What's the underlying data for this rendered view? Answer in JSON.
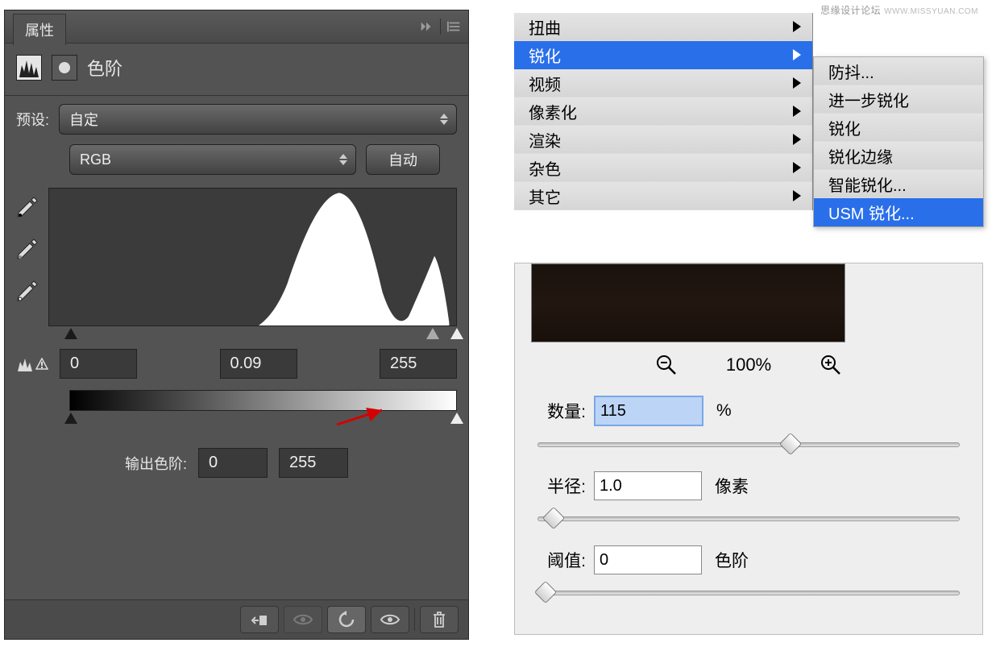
{
  "watermark": {
    "cn": "思缘设计论坛",
    "en": "WWW.MISSYUAN.COM"
  },
  "levels": {
    "panel_title": "属性",
    "title": "色阶",
    "preset_label": "预设:",
    "preset_value": "自定",
    "channel_value": "RGB",
    "auto_label": "自动",
    "input_black": "0",
    "input_gamma": "0.09",
    "input_white": "255",
    "output_label": "输出色阶:",
    "output_black": "0",
    "output_white": "255"
  },
  "menu": {
    "main": [
      {
        "label": "扭曲",
        "hl": false
      },
      {
        "label": "锐化",
        "hl": true
      },
      {
        "label": "视频",
        "hl": false
      },
      {
        "label": "像素化",
        "hl": false
      },
      {
        "label": "渲染",
        "hl": false
      },
      {
        "label": "杂色",
        "hl": false
      },
      {
        "label": "其它",
        "hl": false
      }
    ],
    "sub": [
      {
        "label": "防抖...",
        "hl": false
      },
      {
        "label": "进一步锐化",
        "hl": false
      },
      {
        "label": "锐化",
        "hl": false
      },
      {
        "label": "锐化边缘",
        "hl": false
      },
      {
        "label": "智能锐化...",
        "hl": false
      },
      {
        "label": "USM 锐化...",
        "hl": true
      }
    ]
  },
  "usm": {
    "zoom_text": "100%",
    "amount_label": "数量:",
    "amount_value": "115",
    "amount_unit": "%",
    "radius_label": "半径:",
    "radius_value": "1.0",
    "radius_unit": "像素",
    "threshold_label": "阈值:",
    "threshold_value": "0",
    "threshold_unit": "色阶"
  }
}
